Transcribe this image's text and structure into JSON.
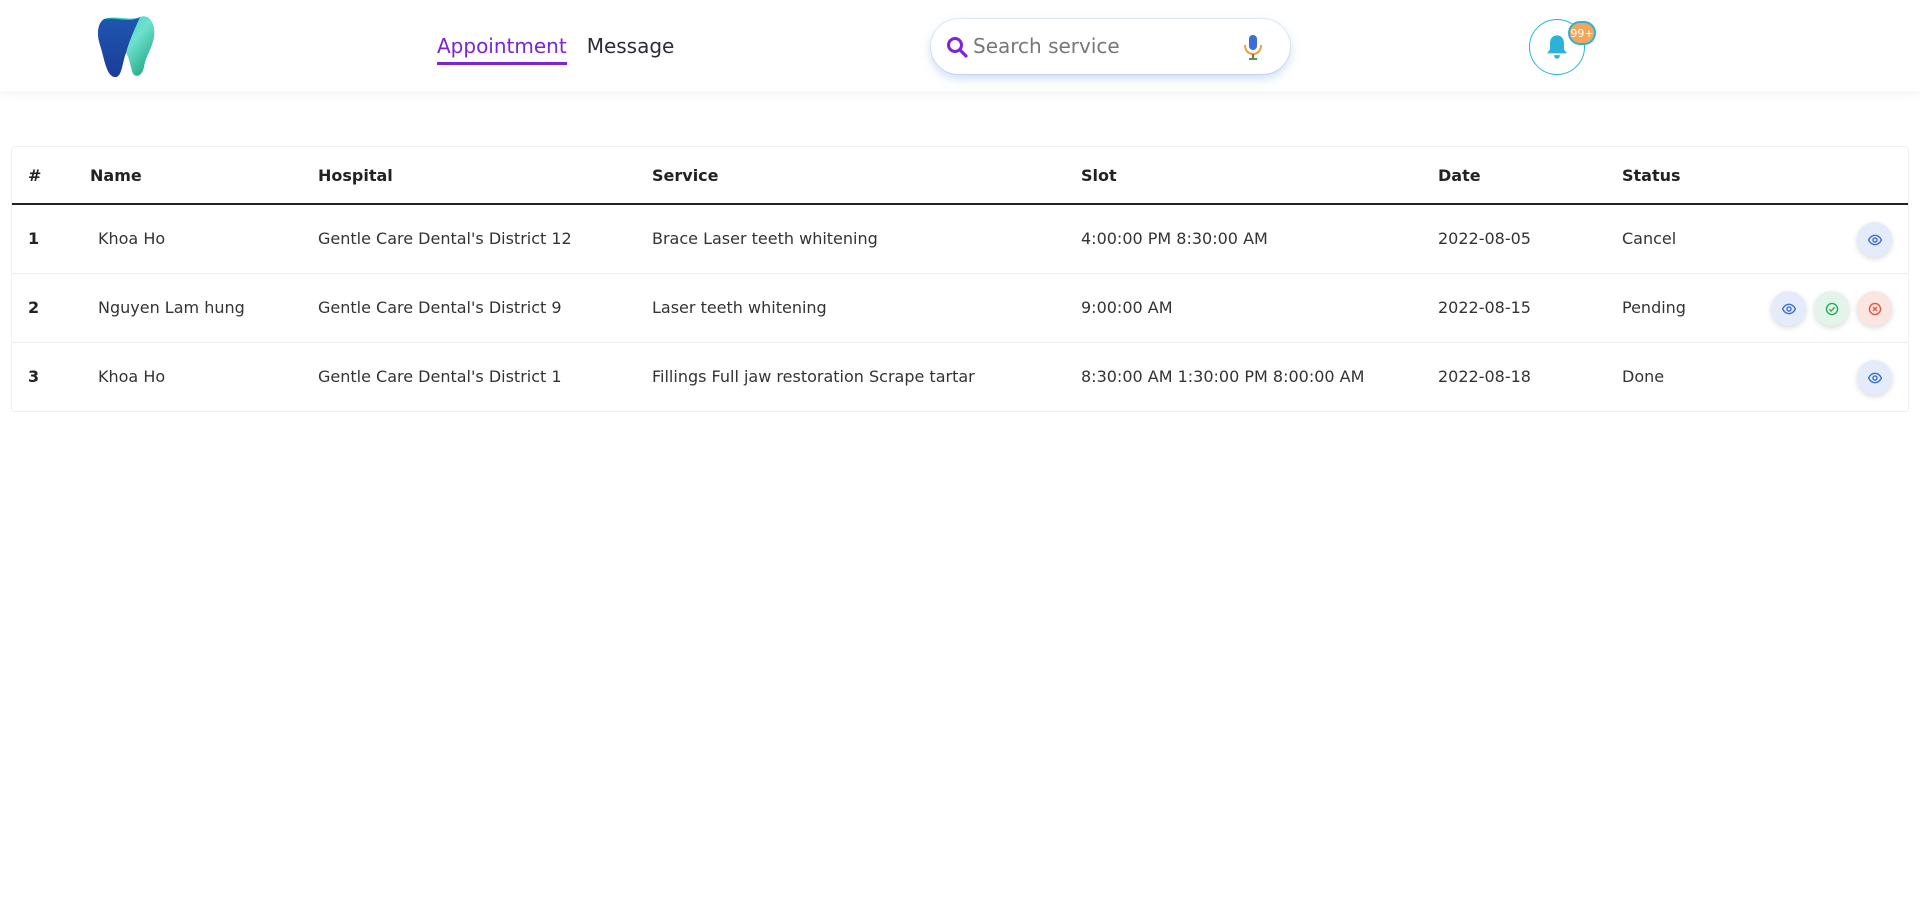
{
  "nav": {
    "tabs": [
      {
        "label": "Appointment",
        "active": true
      },
      {
        "label": "Message",
        "active": false
      }
    ]
  },
  "search": {
    "placeholder": "Search service"
  },
  "notifications": {
    "badge": "99+"
  },
  "colors": {
    "accent": "#7b25d6",
    "bell": "#2ab3d6",
    "badge": "#f2a65a"
  },
  "table": {
    "columns": [
      "#",
      "Name",
      "Hospital",
      "Service",
      "Slot",
      "Date",
      "Status"
    ],
    "rows": [
      {
        "num": "1",
        "name": "Khoa Ho",
        "hospital": "Gentle Care Dental's District 12",
        "service": "Brace Laser teeth whitening",
        "slot": "4:00:00 PM 8:30:00 AM",
        "date": "2022-08-05",
        "status": "Cancel"
      },
      {
        "num": "2",
        "name": "Nguyen Lam hung",
        "hospital": "Gentle Care Dental's District 9",
        "service": "Laser teeth whitening",
        "slot": "9:00:00 AM",
        "date": "2022-08-15",
        "status": "Pending"
      },
      {
        "num": "3",
        "name": "Khoa Ho",
        "hospital": "Gentle Care Dental's District 1",
        "service": "Fillings Full jaw restoration Scrape tartar",
        "slot": "8:30:00 AM 1:30:00 PM 8:00:00 AM",
        "date": "2022-08-18",
        "status": "Done"
      }
    ]
  }
}
